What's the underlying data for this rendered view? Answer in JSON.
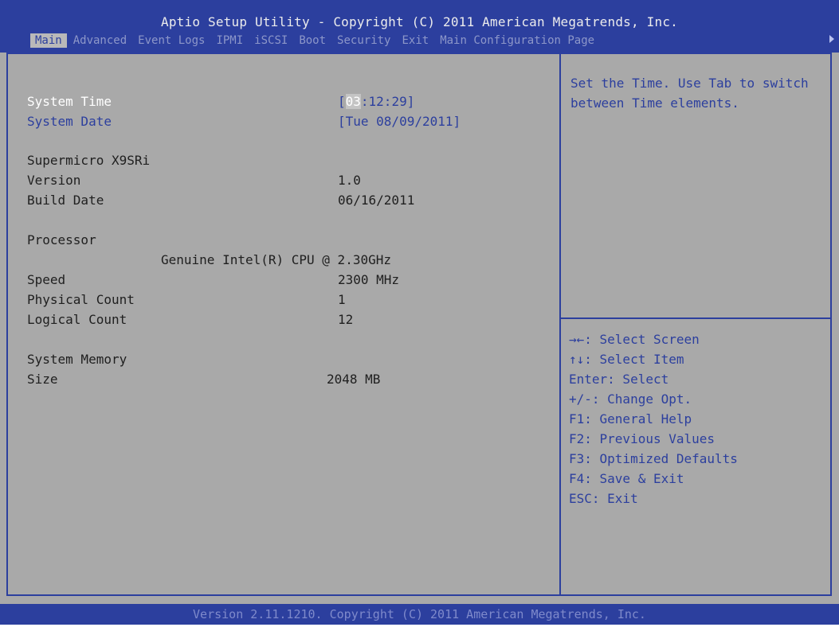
{
  "header": {
    "title": "Aptio Setup Utility - Copyright (C) 2011 American Megatrends, Inc.",
    "tabs": [
      {
        "label": "Main",
        "active": true
      },
      {
        "label": "Advanced",
        "active": false
      },
      {
        "label": "Event Logs",
        "active": false
      },
      {
        "label": "IPMI",
        "active": false
      },
      {
        "label": "iSCSI",
        "active": false
      },
      {
        "label": "Boot",
        "active": false
      },
      {
        "label": "Security",
        "active": false
      },
      {
        "label": "Exit",
        "active": false
      },
      {
        "label": "Main Configuration Page",
        "active": false
      }
    ]
  },
  "main": {
    "system_time": {
      "label": "System Time",
      "bracket_open": "[",
      "hour": "03",
      "rest": ":12:29]"
    },
    "system_date": {
      "label": "System Date",
      "value": "[Tue 08/09/2011]"
    },
    "board": {
      "name": "Supermicro X9SRi"
    },
    "version": {
      "label": "Version",
      "value": "1.0"
    },
    "build_date": {
      "label": "Build Date",
      "value": "06/16/2011"
    },
    "processor": {
      "label": "Processor",
      "name": "Genuine Intel(R) CPU  @ 2.30GHz"
    },
    "speed": {
      "label": "Speed",
      "value": "2300 MHz"
    },
    "physical_count": {
      "label": "Physical Count",
      "value": "1"
    },
    "logical_count": {
      "label": "Logical Count",
      "value": "12"
    },
    "system_memory": {
      "label": "System Memory"
    },
    "size": {
      "label": "Size",
      "value": "2048 MB"
    }
  },
  "help": {
    "description": "Set the Time. Use Tab to switch between Time elements.",
    "keys": [
      "→←: Select Screen",
      "↑↓: Select Item",
      "Enter: Select",
      "+/-: Change Opt.",
      "F1: General Help",
      "F2: Previous Values",
      "F3: Optimized Defaults",
      "F4: Save & Exit",
      "ESC: Exit"
    ]
  },
  "footer": {
    "text": "Version 2.11.1210. Copyright (C) 2011 American Megatrends, Inc."
  },
  "colors": {
    "bar_blue": "#2c3f9e",
    "background_gray": "#a9a9a9",
    "inactive_tab": "#8d97c9"
  }
}
